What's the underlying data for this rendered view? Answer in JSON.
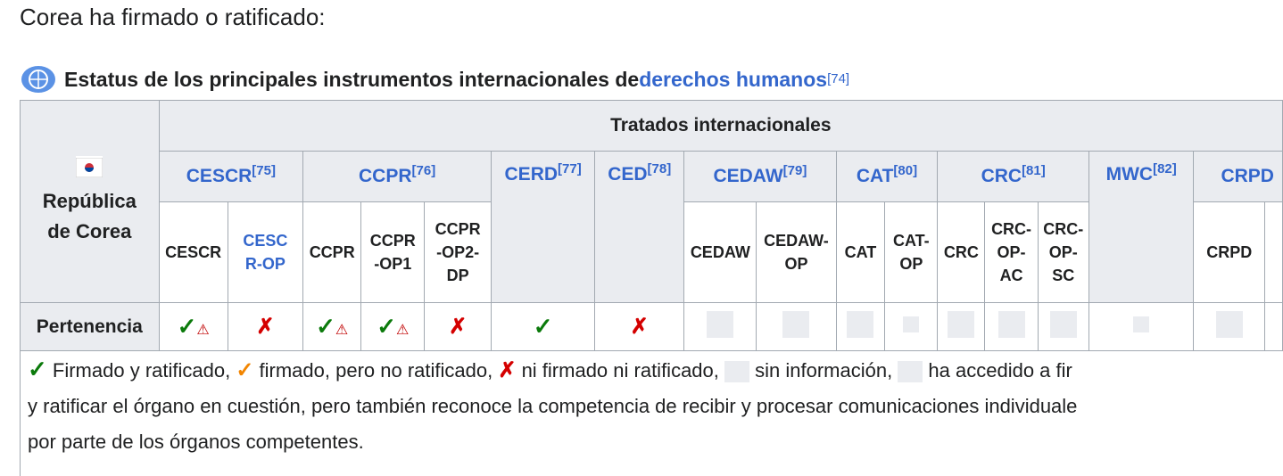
{
  "intro": "Corea ha firmado o ratificado:",
  "caption": {
    "text": "Estatus de los principales instrumentos internacionales de ",
    "link": "derechos humanos",
    "ref": "[74]"
  },
  "table": {
    "header_title": "Tratados internacionales",
    "country": {
      "line1": "República",
      "line2": "de Corea"
    },
    "groups": [
      {
        "name": "CESCR",
        "ref": "[75]"
      },
      {
        "name": "CCPR",
        "ref": "[76]"
      },
      {
        "name": "CERD",
        "ref": "[77]"
      },
      {
        "name": "CED",
        "ref": "[78]"
      },
      {
        "name": "CEDAW",
        "ref": "[79]"
      },
      {
        "name": "CAT",
        "ref": "[80]"
      },
      {
        "name": "CRC",
        "ref": "[81]"
      },
      {
        "name": "MWC",
        "ref": "[82]"
      },
      {
        "name": "CRPD",
        "ref": ""
      }
    ],
    "subs": [
      "CESCR",
      "CESCR-OP",
      "CCPR",
      "CCPR-OP1",
      "CCPR-OP2-DP",
      "CEDAW",
      "CEDAW-OP",
      "CAT",
      "CAT-OP",
      "CRC",
      "CRC-OP-AC",
      "CRC-OP-SC",
      "CRPD"
    ],
    "membership_label": "Pertenencia",
    "status_symbols": {
      "ok": "✓",
      "no": "✗",
      "warn": "⚠"
    }
  },
  "legend": {
    "ok_text": " Firmado y ratificado, ",
    "signed_text": " firmado, pero no ratificado, ",
    "none_text": " ni firmado ni ratificado, ",
    "noinfo_text": " sin información, ",
    "acceded_text": " ha accedido a fir",
    "line2": "y ratificar el órgano en cuestión, pero también reconoce la competencia de recibir y procesar comunicaciones individuale",
    "line3": "por parte de los órganos competentes."
  },
  "colors": {
    "link": "#3366cc",
    "ok": "#0b7a0b",
    "no": "#d40000",
    "signed": "#f28500",
    "header_bg": "#eaecf0"
  }
}
